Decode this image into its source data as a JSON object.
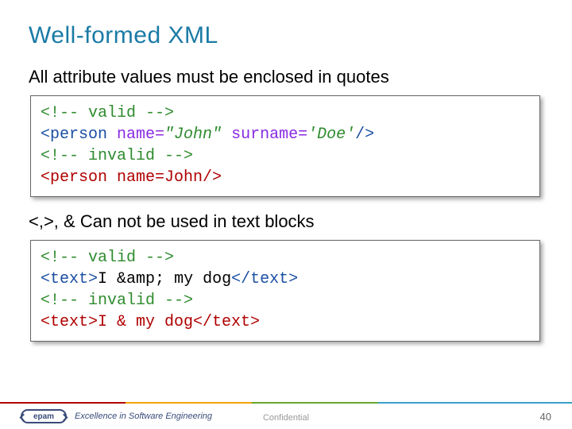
{
  "title": "Well-formed XML",
  "sub1": "All attribute values must be enclosed in quotes",
  "sub2": "<,>, & Can not be used in text blocks",
  "code1": {
    "c_valid": "<!-- valid -->",
    "l_open": "<",
    "l_tag": "person ",
    "l_a1n": "name=",
    "l_a1v": "\"John\" ",
    "l_a2n": "surname=",
    "l_a2v": "'Doe'",
    "l_close": "/>",
    "c_invalid": "<!-- invalid -->",
    "bad": "<person name=John/>"
  },
  "code2": {
    "c_valid": "<!-- valid -->",
    "g_open": "<",
    "g_tag": "text",
    "g_gt": ">",
    "g_body": "I &amp; my dog",
    "g_copen": "</",
    "c_invalid": "<!-- invalid -->",
    "bad": "<text>I & my dog</text>"
  },
  "footer": {
    "brand": "epam",
    "tagline": "Excellence in Software Engineering",
    "confidential": "Confidential",
    "page": "40"
  }
}
